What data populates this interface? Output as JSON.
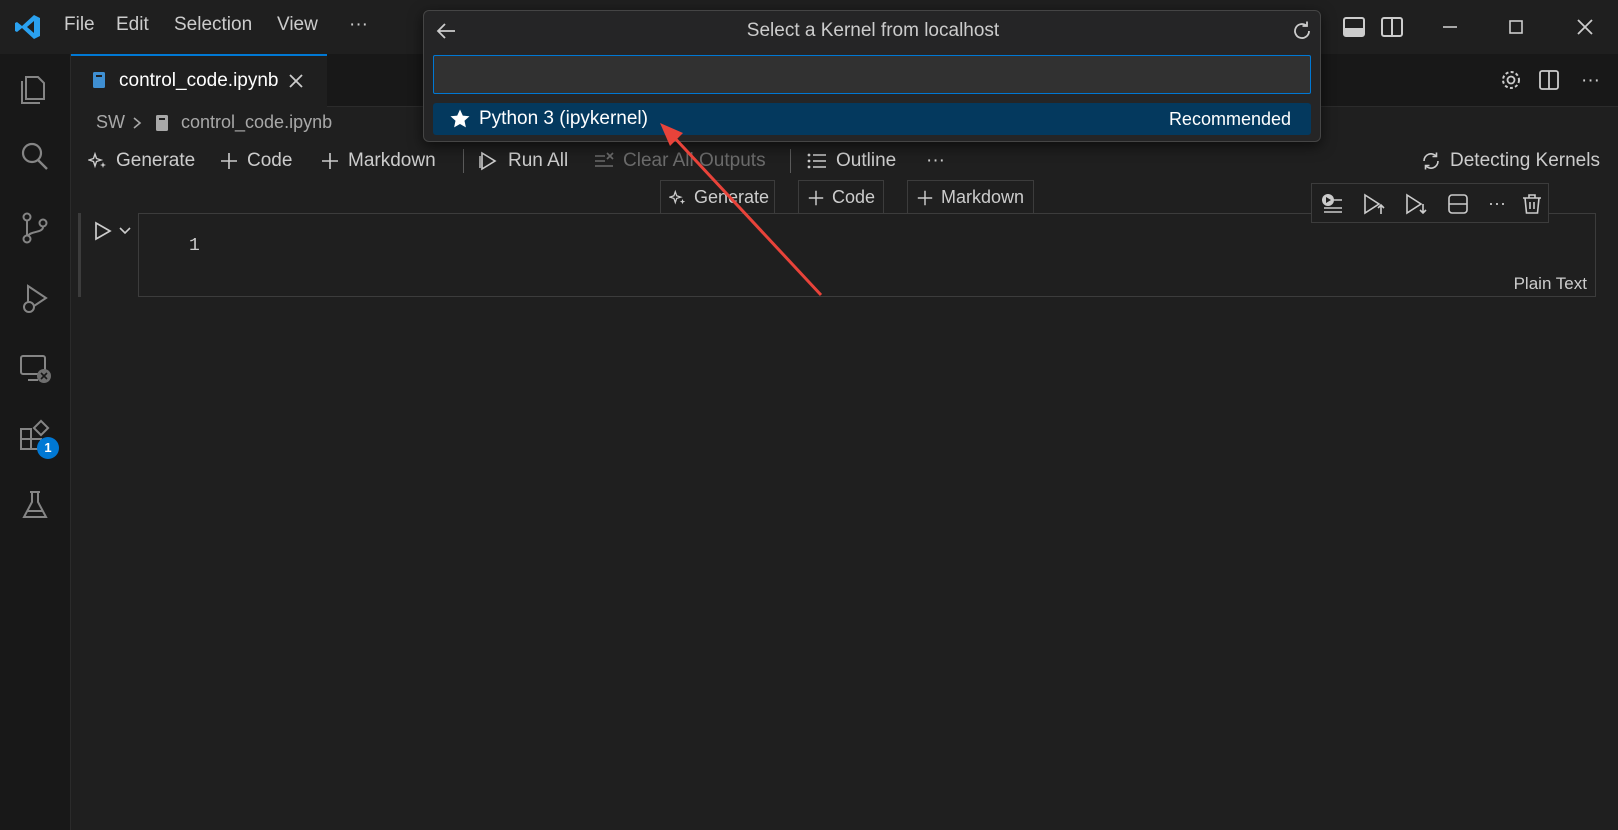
{
  "titlebar": {
    "menu": [
      "File",
      "Edit",
      "Selection",
      "View",
      "···"
    ]
  },
  "activitybar": {
    "items": [
      "explorer-icon",
      "search-icon",
      "source-control-icon",
      "run-debug-icon",
      "remote-explorer-icon",
      "extensions-icon",
      "testing-icon"
    ],
    "extensions_badge": "1",
    "badge_color": "#0078d4"
  },
  "tabs": [
    {
      "label": "control_code.ipynb",
      "active": true
    }
  ],
  "breadcrumb": {
    "folder": "SW",
    "file": "control_code.ipynb"
  },
  "notebook_toolbar": {
    "generate": "Generate",
    "code": "Code",
    "markdown": "Markdown",
    "run_all": "Run All",
    "clear_outputs": "Clear All Outputs",
    "outline": "Outline",
    "more": "···",
    "kernel_status": "Detecting Kernels"
  },
  "insert_bar": {
    "generate": "Generate",
    "code": "Code",
    "markdown": "Markdown"
  },
  "cell": {
    "line_number": "1",
    "language": "Plain Text"
  },
  "quick_pick": {
    "title": "Select a Kernel from localhost",
    "input_value": "",
    "items": [
      {
        "label": "Python 3 (ipykernel)",
        "detail": "Recommended",
        "selected": true
      }
    ]
  },
  "colors": {
    "accent": "#0078d4",
    "selection": "#04395e",
    "annotation_arrow": "#e8433a"
  }
}
